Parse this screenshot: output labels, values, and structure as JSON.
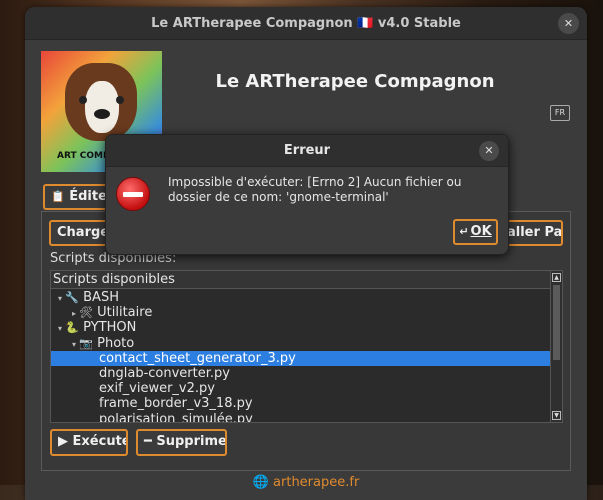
{
  "window": {
    "title": "Le ARTherapee Compagnon 🇫🇷 v4.0 Stable",
    "close_glyph": "✕"
  },
  "header": {
    "app_title": "Le ARTherapee Compagnon",
    "logo_caption": "ART COMP",
    "lang_icon_text": "FR"
  },
  "tabs": {
    "edit_label": "Édite"
  },
  "toolbar": {
    "charger_label": "Charger",
    "installer_label": "aller Pack"
  },
  "scripts": {
    "label": "Scripts disponibles:",
    "tree_header": "Scripts disponibles",
    "rows": [
      {
        "arrow": "▾",
        "icon": "🔧",
        "label": "BASH",
        "indent": 0
      },
      {
        "arrow": "▸",
        "icon": "🛠",
        "label": "Utilitaire",
        "indent": 1
      },
      {
        "arrow": "▾",
        "icon": "🐍",
        "label": "PYTHON",
        "indent": 0
      },
      {
        "arrow": "▾",
        "icon": "📷",
        "label": "Photo",
        "indent": 1
      },
      {
        "arrow": "",
        "icon": "",
        "label": "contact_sheet_generator_3.py",
        "indent": 2,
        "selected": true
      },
      {
        "arrow": "",
        "icon": "",
        "label": "dnglab-converter.py",
        "indent": 2
      },
      {
        "arrow": "",
        "icon": "",
        "label": "exif_viewer_v2.py",
        "indent": 2
      },
      {
        "arrow": "",
        "icon": "",
        "label": "frame_border_v3_18.py",
        "indent": 2
      },
      {
        "arrow": "",
        "icon": "",
        "label": "polarisation_simulée.py",
        "indent": 2
      }
    ]
  },
  "actions": {
    "execute_label": "Exécuter",
    "execute_icon": "▶",
    "delete_label": "Supprimer",
    "delete_icon": "━"
  },
  "footer": {
    "globe_icon": "🌐",
    "link": "artherapee.fr"
  },
  "dialog": {
    "title": "Erreur",
    "close_glyph": "✕",
    "message": "Impossible d'exécuter: [Errno 2] Aucun fichier ou dossier de ce nom: 'gnome-terminal'",
    "ok_label": "OK",
    "ok_icon": "↵"
  },
  "colors": {
    "accent": "#e08a2e",
    "selection": "#2c7fe0",
    "window_bg": "#3b3b3b"
  }
}
